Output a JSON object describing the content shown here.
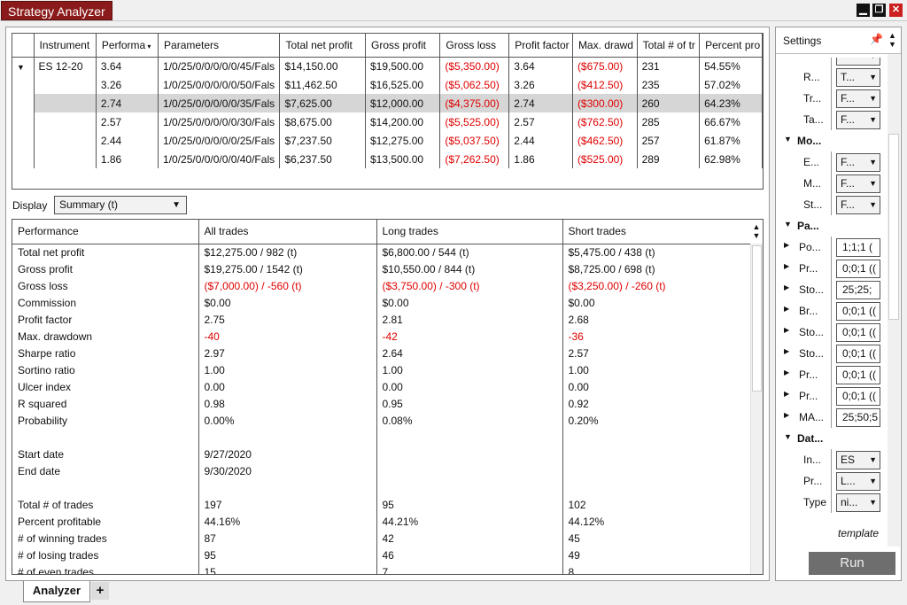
{
  "window": {
    "title": "Strategy Analyzer",
    "min": "▁",
    "restore": "❐",
    "close": "✕"
  },
  "results": {
    "columns": [
      "Instrument",
      "Performa",
      "Parameters",
      "Total net profit",
      "Gross profit",
      "Gross loss",
      "Profit factor",
      "Max. drawd",
      "Total # of tr",
      "Percent pro"
    ],
    "instrument": "ES 12-20",
    "rows": [
      [
        "3.64",
        "1/0/25/0/0/0/0/0/45/Fals",
        "$14,150.00",
        "$19,500.00",
        "($5,350.00)",
        "3.64",
        "($675.00)",
        "231",
        "54.55%"
      ],
      [
        "3.26",
        "1/0/25/0/0/0/0/0/50/Fals",
        "$11,462.50",
        "$16,525.00",
        "($5,062.50)",
        "3.26",
        "($412.50)",
        "235",
        "57.02%"
      ],
      [
        "2.74",
        "1/0/25/0/0/0/0/0/35/Fals",
        "$7,625.00",
        "$12,000.00",
        "($4,375.00)",
        "2.74",
        "($300.00)",
        "260",
        "64.23%"
      ],
      [
        "2.57",
        "1/0/25/0/0/0/0/0/30/Fals",
        "$8,675.00",
        "$14,200.00",
        "($5,525.00)",
        "2.57",
        "($762.50)",
        "285",
        "66.67%"
      ],
      [
        "2.44",
        "1/0/25/0/0/0/0/0/25/Fals",
        "$7,237.50",
        "$12,275.00",
        "($5,037.50)",
        "2.44",
        "($462.50)",
        "257",
        "61.87%"
      ],
      [
        "1.86",
        "1/0/25/0/0/0/0/0/40/Fals",
        "$6,237.50",
        "$13,500.00",
        "($7,262.50)",
        "1.86",
        "($525.00)",
        "289",
        "62.98%"
      ]
    ],
    "selected_row": 2
  },
  "display": {
    "label": "Display",
    "value": "Summary (t)"
  },
  "summary": {
    "headers": [
      "Performance",
      "All trades",
      "Long trades",
      "Short trades"
    ],
    "rows": [
      [
        "Total net profit",
        "$12,275.00 / 982 (t)",
        "$6,800.00 / 544 (t)",
        "$5,475.00 / 438 (t)",
        false
      ],
      [
        "Gross profit",
        "$19,275.00 / 1542 (t)",
        "$10,550.00 / 844 (t)",
        "$8,725.00 / 698 (t)",
        false
      ],
      [
        "Gross loss",
        "($7,000.00) / -560 (t)",
        "($3,750.00) / -300 (t)",
        "($3,250.00) / -260 (t)",
        true
      ],
      [
        "Commission",
        "$0.00",
        "$0.00",
        "$0.00",
        false
      ],
      [
        "Profit factor",
        "2.75",
        "2.81",
        "2.68",
        false
      ],
      [
        "Max. drawdown",
        "-40",
        "-42",
        "-36",
        true
      ],
      [
        "Sharpe ratio",
        "2.97",
        "2.64",
        "2.57",
        false
      ],
      [
        "Sortino ratio",
        "1.00",
        "1.00",
        "1.00",
        false
      ],
      [
        "Ulcer index",
        "0.00",
        "0.00",
        "0.00",
        false
      ],
      [
        "R squared",
        "0.98",
        "0.95",
        "0.92",
        false
      ],
      [
        "Probability",
        "0.00%",
        "0.08%",
        "0.20%",
        false
      ],
      [
        "",
        "",
        "",
        "",
        false
      ],
      [
        "Start date",
        "9/27/2020",
        "",
        "",
        false
      ],
      [
        "End date",
        "9/30/2020",
        "",
        "",
        false
      ],
      [
        "",
        "",
        "",
        "",
        false
      ],
      [
        "Total # of trades",
        "197",
        "95",
        "102",
        false
      ],
      [
        "Percent profitable",
        "44.16%",
        "44.21%",
        "44.12%",
        false
      ],
      [
        "# of winning trades",
        "87",
        "42",
        "45",
        false
      ],
      [
        "# of losing trades",
        "95",
        "46",
        "49",
        false
      ],
      [
        "# of even trades",
        "15",
        "7",
        "8",
        false
      ]
    ]
  },
  "settings": {
    "title": "Settings",
    "rows": [
      {
        "kind": "field",
        "label": "",
        "value": "",
        "type": "sel"
      },
      {
        "kind": "field",
        "label": "R...",
        "value": "T...",
        "type": "sel"
      },
      {
        "kind": "field",
        "label": "Tr...",
        "value": "F...",
        "type": "sel"
      },
      {
        "kind": "field",
        "label": "Ta...",
        "value": "F...",
        "type": "sel"
      },
      {
        "kind": "cat",
        "label": "Mo..."
      },
      {
        "kind": "field",
        "label": "E...",
        "value": "F...",
        "type": "sel"
      },
      {
        "kind": "field",
        "label": "M...",
        "value": "F...",
        "type": "sel"
      },
      {
        "kind": "field",
        "label": "St...",
        "value": "F...",
        "type": "sel"
      },
      {
        "kind": "cat",
        "label": "Pa..."
      },
      {
        "kind": "param",
        "label": "Po...",
        "value": "1;1;1 (",
        "type": "txt"
      },
      {
        "kind": "param",
        "label": "Pr...",
        "value": "0;0;1 ((",
        "type": "txt"
      },
      {
        "kind": "param",
        "label": "Sto...",
        "value": "25;25;",
        "type": "txt"
      },
      {
        "kind": "param",
        "label": "Br...",
        "value": "0;0;1 ((",
        "type": "txt"
      },
      {
        "kind": "param",
        "label": "Sto...",
        "value": "0;0;1 ((",
        "type": "txt"
      },
      {
        "kind": "param",
        "label": "Sto...",
        "value": "0;0;1 ((",
        "type": "txt"
      },
      {
        "kind": "param",
        "label": "Pr...",
        "value": "0;0;1 ((",
        "type": "txt"
      },
      {
        "kind": "param",
        "label": "Pr...",
        "value": "0;0;1 ((",
        "type": "txt"
      },
      {
        "kind": "param",
        "label": "MA...",
        "value": "25;50;5",
        "type": "txt"
      },
      {
        "kind": "cat",
        "label": "Dat..."
      },
      {
        "kind": "field",
        "label": "In...",
        "value": "ES",
        "type": "sel"
      },
      {
        "kind": "field",
        "label": "Pr...",
        "value": "L...",
        "type": "sel"
      },
      {
        "kind": "field",
        "label": "Type",
        "value": "ni...",
        "type": "sel"
      }
    ],
    "template": "template",
    "run": "Run"
  },
  "tabs": {
    "active": "Analyzer",
    "add": "+"
  }
}
